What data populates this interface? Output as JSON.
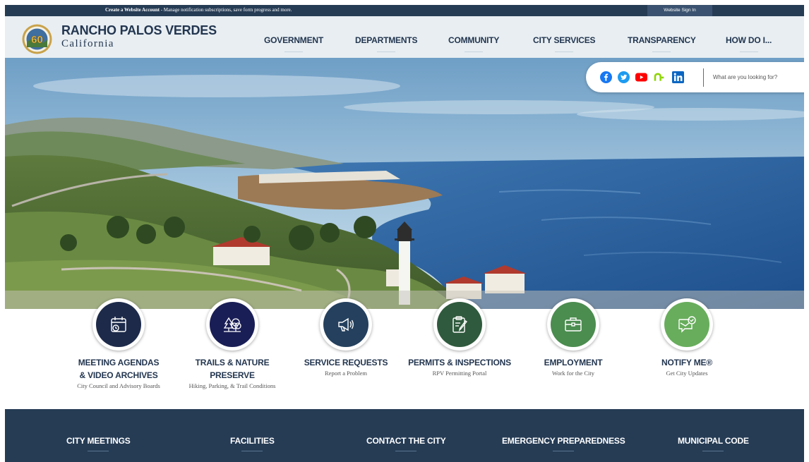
{
  "topbar": {
    "account_strong": "Create a Website Account",
    "account_rest": " - Manage notification subscriptions, save form progress and more.",
    "signin_label": "Website Sign In"
  },
  "brand": {
    "name": "RANCHO PALOS VERDES",
    "state": "California",
    "seal_text": "60"
  },
  "nav": {
    "items": [
      "GOVERNMENT",
      "DEPARTMENTS",
      "COMMUNITY",
      "CITY SERVICES",
      "TRANSPARENCY",
      "HOW DO I..."
    ]
  },
  "social": {
    "icons": [
      "facebook-icon",
      "twitter-icon",
      "youtube-icon",
      "nextdoor-icon",
      "linkedin-icon"
    ],
    "colors": {
      "facebook": "#1877f2",
      "twitter": "#1d9bf0",
      "youtube": "#ff0000",
      "nextdoor": "#8ed500",
      "linkedin": "#0a66c2"
    }
  },
  "search": {
    "placeholder": "What are you looking for?"
  },
  "quick_links": [
    {
      "title_line1": "MEETING AGENDAS",
      "title_line2": "& VIDEO ARCHIVES",
      "desc": "City Council and Advisory Boards",
      "icon": "calendar-icon",
      "color": "#1d2a4a"
    },
    {
      "title_line1": "TRAILS & NATURE",
      "title_line2": "PRESERVE",
      "desc": "Hiking, Parking, & Trail Conditions",
      "icon": "trees-icon",
      "color": "#1a1e56"
    },
    {
      "title_line1": "SERVICE REQUESTS",
      "title_line2": "",
      "desc": "Report a Problem",
      "icon": "megaphone-icon",
      "color": "#24405e"
    },
    {
      "title_line1": "PERMITS & INSPECTIONS",
      "title_line2": "",
      "desc": "RPV Permitting Portal",
      "icon": "clipboard-icon",
      "color": "#2f5a3d"
    },
    {
      "title_line1": "EMPLOYMENT",
      "title_line2": "",
      "desc": "Work for the City",
      "icon": "briefcase-icon",
      "color": "#4b8c4f"
    },
    {
      "title_line1": "NOTIFY ME®",
      "title_line2": "",
      "desc": "Get City Updates",
      "icon": "message-check-icon",
      "color": "#68ad5c"
    }
  ],
  "footer": {
    "links": [
      "CITY MEETINGS",
      "FACILITIES",
      "CONTACT THE CITY",
      "EMERGENCY PREPAREDNESS",
      "MUNICIPAL CODE"
    ]
  }
}
